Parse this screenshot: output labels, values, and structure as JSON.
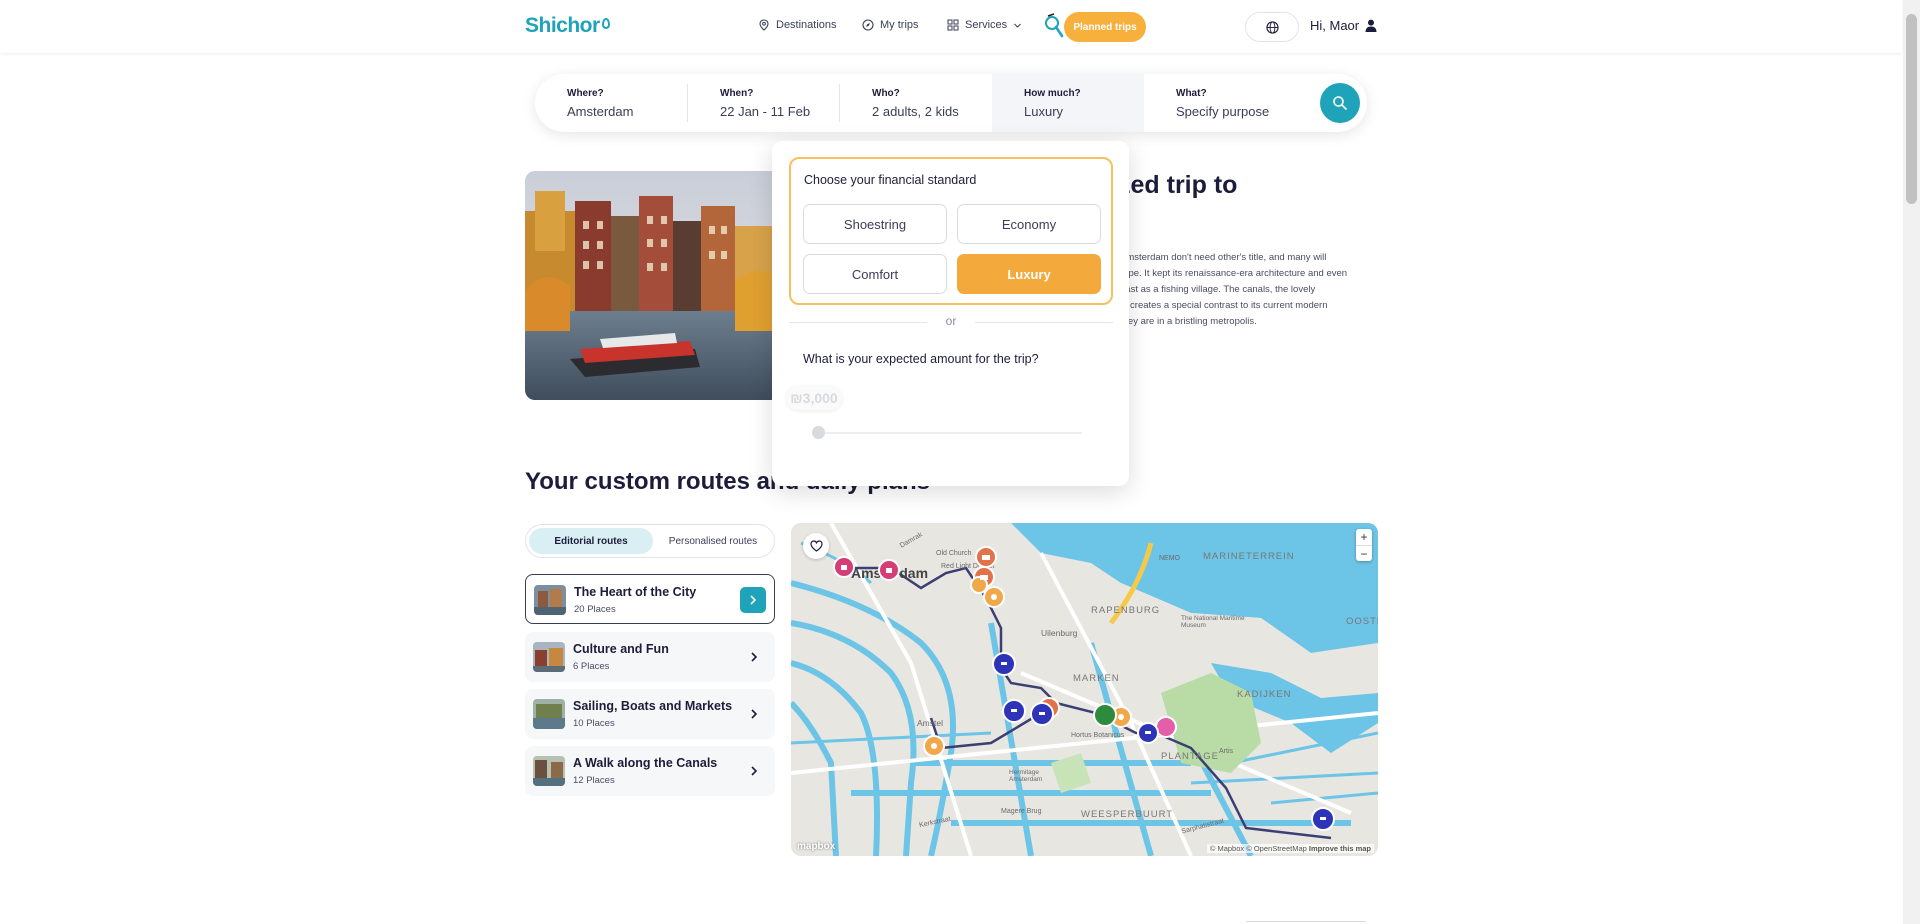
{
  "header": {
    "logo": "Shichor",
    "nav": [
      {
        "label": "Destinations",
        "icon": "pin-icon"
      },
      {
        "label": "My trips",
        "icon": "compass-icon"
      },
      {
        "label": "Services",
        "icon": "grid-icon"
      }
    ],
    "planned_trips": "Planned trips",
    "greeting": "Hi, Maor"
  },
  "search": {
    "fields": [
      {
        "label": "Where?",
        "value": "Amsterdam"
      },
      {
        "label": "When?",
        "value": "22 Jan - 11 Feb"
      },
      {
        "label": "Who?",
        "value": "2 adults, 2 kids"
      },
      {
        "label": "How much?",
        "value": "Luxury"
      },
      {
        "label": "What?",
        "value": "Specify purpose"
      }
    ]
  },
  "hero": {
    "title_visible": "zed trip to",
    "text_lines": [
      "Amsterdam don't need other's title, and many will",
      "rope. It kept its renaissance-era architecture and even",
      "past as a fishing village. The canals, the lovely",
      "ts creates a special contrast to its current modern",
      "they are in a bristling metropolis."
    ]
  },
  "financial": {
    "title": "Choose your financial standard",
    "options": [
      "Shoestring",
      "Economy",
      "Comfort",
      "Luxury"
    ],
    "selected": "Luxury",
    "or": "or",
    "amount_question": "What is your expected amount for the trip?",
    "amount_value": "₪3,000",
    "slider_fraction": 0
  },
  "routes": {
    "title": "Your custom routes and daily plans",
    "tabs": [
      "Editorial routes",
      "Personalised routes"
    ],
    "items": [
      {
        "name": "The Heart of the City",
        "count": "20 Places"
      },
      {
        "name": "Culture and Fun",
        "count": "6 Places"
      },
      {
        "name": "Sailing, Boats and Markets",
        "count": "10 Places"
      },
      {
        "name": "A Walk along the Canals",
        "count": "12 Places"
      }
    ]
  },
  "map": {
    "city": "Amsterdam",
    "labels": [
      "MARINETERREIN",
      "RAPENBURG",
      "Uilenburg",
      "MARKEN",
      "KADIJKEN",
      "PLANTAGE",
      "WEESPERBUURT",
      "Amstel",
      "Hortus Botanicus",
      "Artis",
      "The National Maritime Museum",
      "Hermitage Amsterdam",
      "Magere Brug",
      "Old Church",
      "Red Light District",
      "OOSTE",
      "NEMO",
      "Damrak",
      "Kerkstraat",
      "Sarphatistraat"
    ],
    "attribution": "© Mapbox © OpenStreetMap",
    "improve": "Improve this map",
    "logo": "mapbox",
    "zoom_in": "+",
    "zoom_out": "−"
  },
  "colors": {
    "brand": "#1fa3b8",
    "accent": "#f4a93c"
  }
}
